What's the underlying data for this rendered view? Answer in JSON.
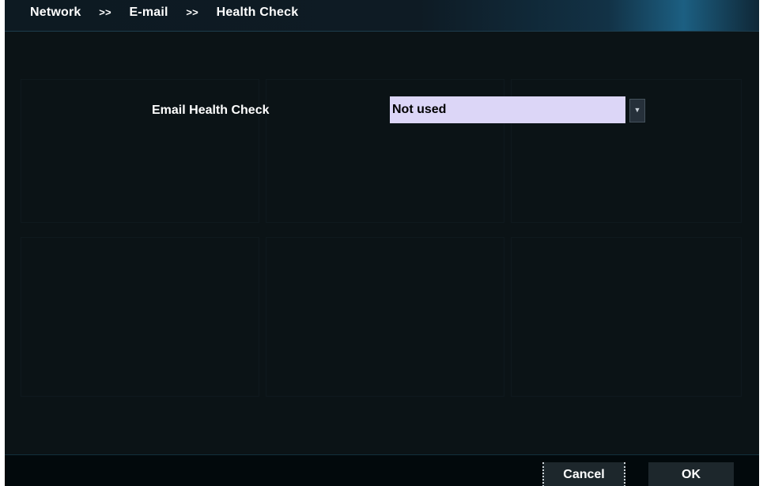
{
  "breadcrumb": {
    "items": [
      "Network",
      "E-mail",
      "Health Check"
    ],
    "separator": ">>"
  },
  "form": {
    "email_health_check": {
      "label": "Email Health Check",
      "value": "Not used"
    }
  },
  "footer": {
    "cancel_label": "Cancel",
    "ok_label": "OK"
  },
  "colors": {
    "background": "#0b1316",
    "select_background": "#dcd6f7",
    "text": "#ffffff"
  }
}
